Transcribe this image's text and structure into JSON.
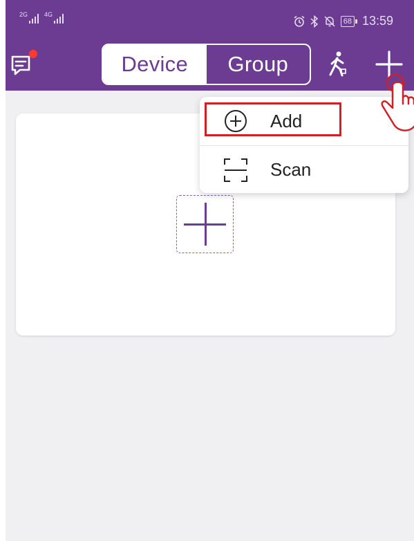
{
  "status_bar": {
    "network_1": "2G",
    "network_2": "4G",
    "battery": "68",
    "time": "13:59",
    "icons": [
      "alarm-icon",
      "bluetooth-icon",
      "mute-icon"
    ]
  },
  "header": {
    "tabs": [
      {
        "label": "Device",
        "active": true
      },
      {
        "label": "Group",
        "active": false
      }
    ],
    "icons": [
      "message-icon",
      "walking-person-icon",
      "plus-icon"
    ]
  },
  "menu": {
    "items": [
      {
        "label": "Add",
        "icon": "add-circle-icon",
        "highlighted": true
      },
      {
        "label": "Scan",
        "icon": "scan-frame-icon",
        "highlighted": false
      }
    ]
  },
  "colors": {
    "brand": "#6b3c92",
    "highlight": "#d11f26",
    "notification_dot": "#ff3b30"
  }
}
